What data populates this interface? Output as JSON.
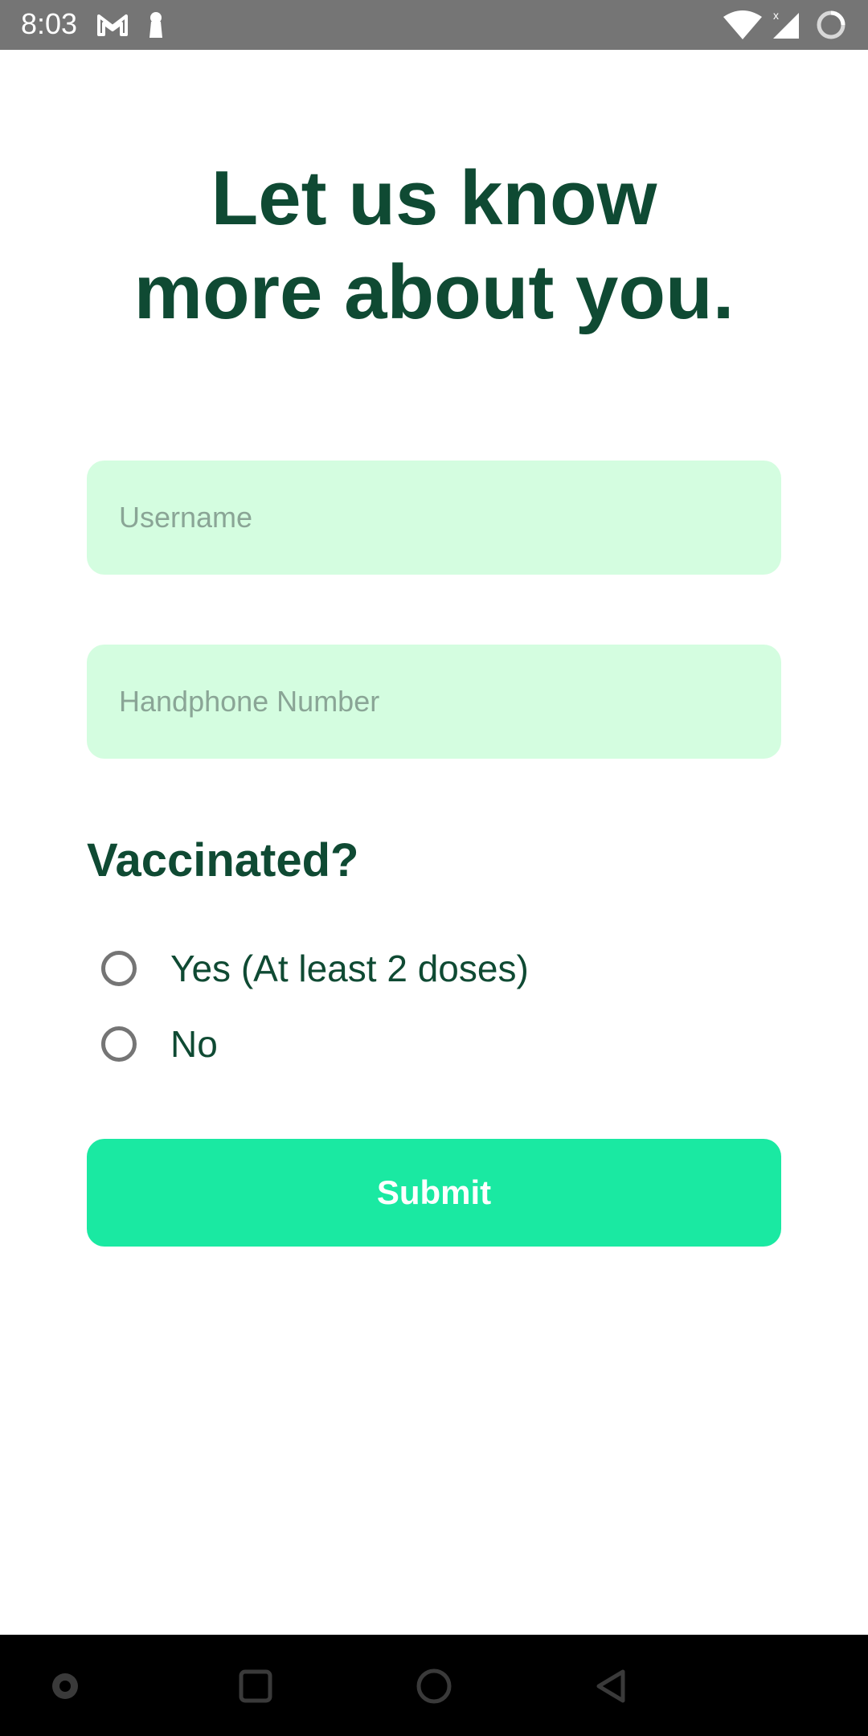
{
  "status_bar": {
    "time": "8:03",
    "icons": [
      "gmail-icon",
      "keyhole-icon",
      "wifi-icon",
      "signal-icon",
      "battery-loading-icon"
    ]
  },
  "header": {
    "title_line1": "Let us know",
    "title_line2": "more about you."
  },
  "form": {
    "username": {
      "value": "",
      "placeholder": "Username"
    },
    "phone": {
      "value": "",
      "placeholder": "Handphone Number"
    },
    "vaccinated_label": "Vaccinated?",
    "options": [
      {
        "label": "Yes (At least 2 doses)",
        "selected": false
      },
      {
        "label": "No",
        "selected": false
      }
    ],
    "submit_label": "Submit"
  },
  "nav_bar": {
    "buttons": [
      "dot-icon",
      "recents-icon",
      "home-icon",
      "back-icon"
    ]
  },
  "colors": {
    "title": "#0f4a33",
    "field_bg": "#d4fde0",
    "submit_bg": "#1ae9a2",
    "status_bar_bg": "#757575",
    "nav_bar_bg": "#000000"
  }
}
